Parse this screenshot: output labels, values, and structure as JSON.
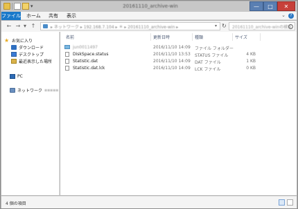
{
  "window": {
    "title": "20161110_archive-win",
    "min_label": "—",
    "max_label": "□",
    "close_label": "✕"
  },
  "ribbon": {
    "tabs": [
      "ファイル",
      "ホーム",
      "共有",
      "表示"
    ],
    "help": "?"
  },
  "nav": {
    "back": "←",
    "forward": "→",
    "up": "↑",
    "address": "▸ ネットワーク ▸ 192.168.7.104 ▸ ＊ ▸ 20161110_archive-win ▸",
    "refresh": "↻",
    "search_placeholder": "20161110_archive-winの検索"
  },
  "navpane": {
    "favorites_label": "お気に入り",
    "items": [
      "ダウンロード",
      "デスクトップ",
      "最近表示した場所"
    ],
    "pc_label": "PC",
    "network_label": "ネットワーク"
  },
  "columns": {
    "name": "名前",
    "date": "更新日時",
    "type": "種類",
    "size": "サイズ"
  },
  "files": [
    {
      "name": "jun0011497",
      "date": "2016/11/10 14:09",
      "type": "ファイル フォルダー",
      "size": "",
      "kind": "folder"
    },
    {
      "name": "DiskSpace.status",
      "date": "2016/11/10 13:53",
      "type": "STATUS ファイル",
      "size": "4 KB",
      "kind": "file"
    },
    {
      "name": "Statistic.dat",
      "date": "2016/11/10 14:09",
      "type": "DAT ファイル",
      "size": "1 KB",
      "kind": "file"
    },
    {
      "name": "Statistic.dat.lck",
      "date": "2016/11/10 14:09",
      "type": "LCK ファイル",
      "size": "0 KB",
      "kind": "file"
    }
  ],
  "status": {
    "item_count": "4 個の項目"
  },
  "colors": {
    "file_tab": "#1979ca",
    "close_button": "#c7403a",
    "header_text": "#4c5a74"
  }
}
